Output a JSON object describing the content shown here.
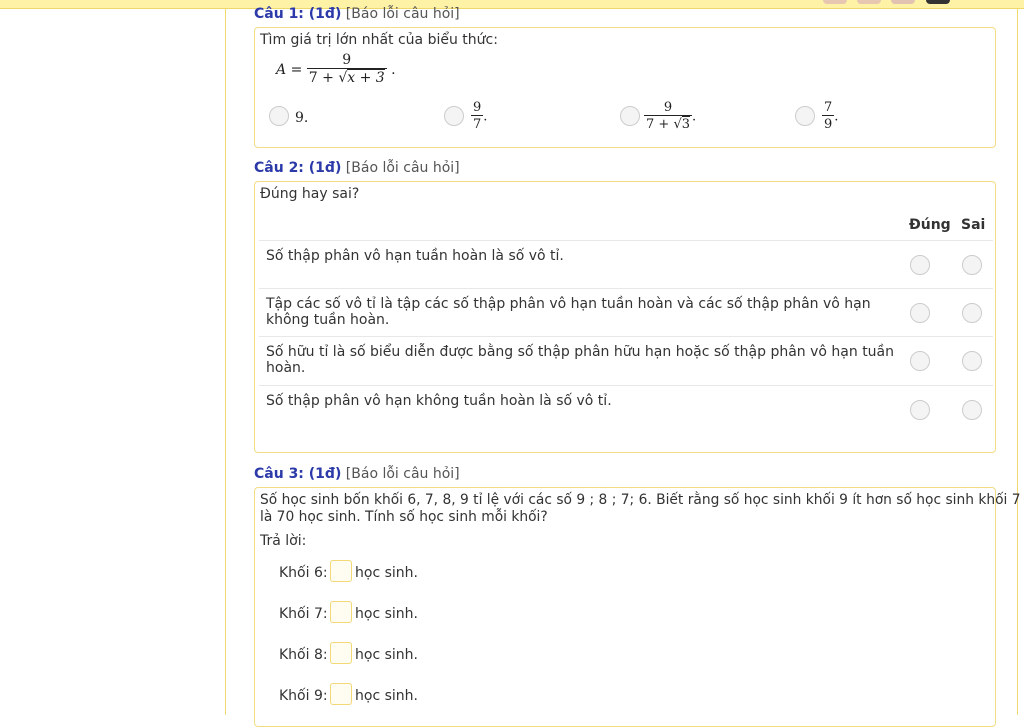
{
  "q1": {
    "number": "Câu 1: (1đ)",
    "report": "[Báo lỗi câu hỏi]",
    "prompt": "Tìm giá trị lớn nhất của biểu thức:",
    "expr_lhs": "A",
    "expr_eq": "=",
    "expr_num": "9",
    "expr_den_pre": "7 + ",
    "expr_den_rad": "x + 3",
    "expr_tail": ".",
    "options": [
      {
        "text": "9."
      },
      {
        "num": "9",
        "den": "7",
        "tail": "."
      },
      {
        "num": "9",
        "den_pre": "7 + ",
        "den_rad": "3",
        "tail": "."
      },
      {
        "num": "7",
        "den": "9",
        "tail": "."
      }
    ]
  },
  "q2": {
    "number": "Câu 2: (1đ)",
    "report": "[Báo lỗi câu hỏi]",
    "prompt": "Đúng hay sai?",
    "col_true": "Đúng",
    "col_false": "Sai",
    "rows": [
      "Số thập phân vô hạn tuần hoàn là số vô tỉ.",
      "Tập các số vô tỉ là tập các số thập phân vô hạn tuần hoàn và các số thập phân vô hạn không tuần hoàn.",
      "Số hữu tỉ là số biểu diễn được bằng số thập phân hữu hạn hoặc số thập phân vô hạn tuần hoàn.",
      "Số thập phân vô hạn không tuần hoàn là số vô tỉ."
    ]
  },
  "q3": {
    "number": "Câu 3: (1đ)",
    "report": "[Báo lỗi câu hỏi]",
    "prompt_line1": "Số học sinh bốn khối 6, 7, 8, 9 tỉ lệ với các số 9 ; 8 ; 7; 6. Biết rằng số học sinh khối 9 ít hơn số học sinh khối 7",
    "prompt_line2": "là 70 học sinh. Tính số học sinh mỗi khối?",
    "answer_label": "Trả lời:",
    "unit": "học sinh.",
    "answers": [
      {
        "label": "Khối 6:",
        "value": ""
      },
      {
        "label": "Khối 7:",
        "value": ""
      },
      {
        "label": "Khối 8:",
        "value": ""
      },
      {
        "label": "Khối 9:",
        "value": ""
      }
    ]
  }
}
